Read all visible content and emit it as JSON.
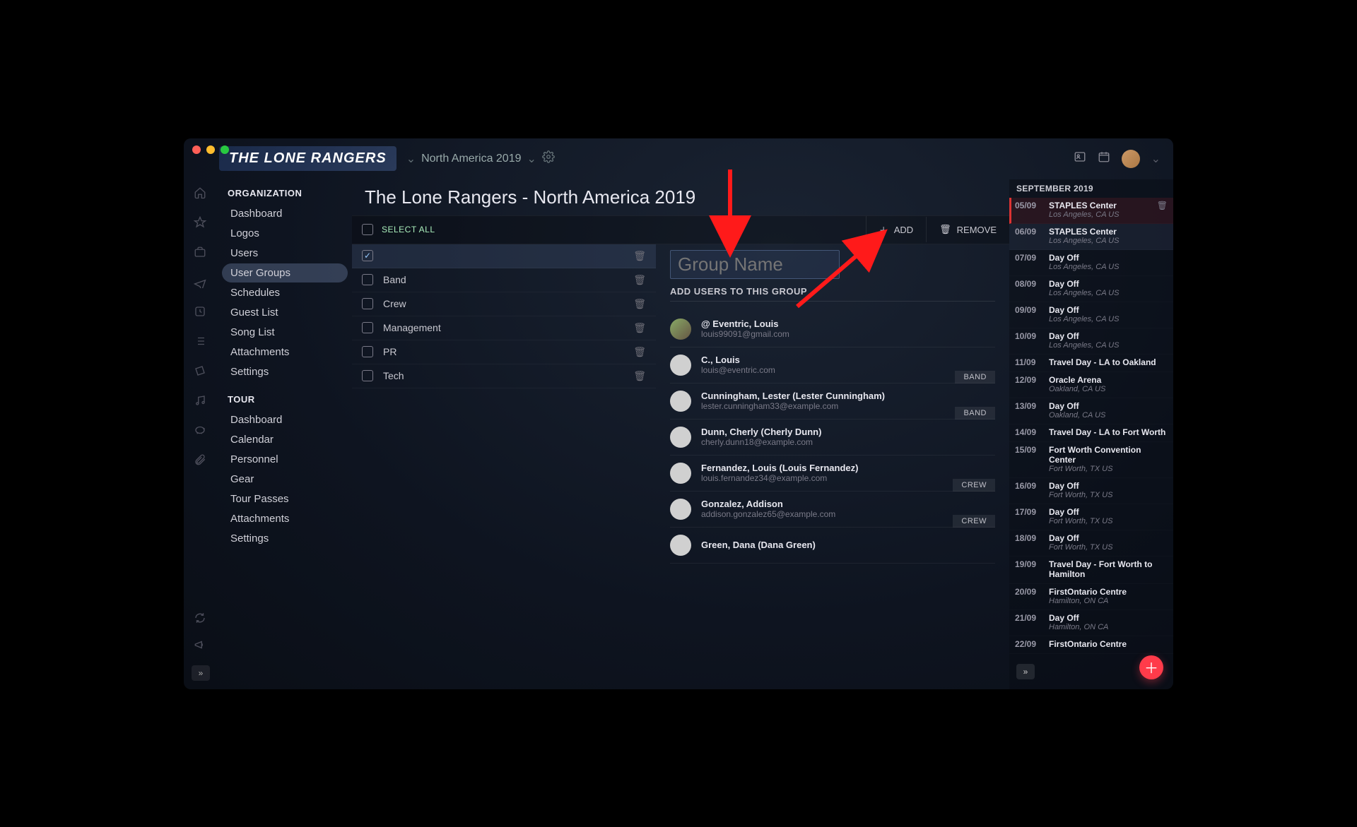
{
  "brand": "THE LONE RANGERS",
  "tour_selector": "North America 2019",
  "page_title": "The Lone Rangers - North America 2019",
  "toolbar": {
    "select_all": "SELECT ALL",
    "add": "ADD",
    "remove": "REMOVE"
  },
  "nav": {
    "organization": {
      "heading": "ORGANIZATION",
      "items": [
        "Dashboard",
        "Logos",
        "Users",
        "User Groups",
        "Schedules",
        "Guest List",
        "Song List",
        "Attachments",
        "Settings"
      ],
      "active": "User Groups"
    },
    "tour": {
      "heading": "TOUR",
      "items": [
        "Dashboard",
        "Calendar",
        "Personnel",
        "Gear",
        "Tour Passes",
        "Attachments",
        "Settings"
      ]
    }
  },
  "groups": [
    {
      "name": "",
      "checked": true,
      "selected": true
    },
    {
      "name": "Band"
    },
    {
      "name": "Crew"
    },
    {
      "name": "Management"
    },
    {
      "name": "PR"
    },
    {
      "name": "Tech"
    }
  ],
  "detail": {
    "group_name_placeholder": "Group Name",
    "add_users_heading": "ADD USERS TO THIS GROUP",
    "users": [
      {
        "name": "@ Eventric, Louis",
        "email": "louis99091@gmail.com",
        "photo": true
      },
      {
        "name": "C., Louis",
        "email": "louis@eventric.com",
        "badge": "BAND"
      },
      {
        "name": "Cunningham, Lester (Lester Cunningham)",
        "email": "lester.cunningham33@example.com",
        "badge": "BAND"
      },
      {
        "name": "Dunn, Cherly (Cherly Dunn)",
        "email": "cherly.dunn18@example.com"
      },
      {
        "name": "Fernandez, Louis (Louis Fernandez)",
        "email": "louis.fernandez34@example.com",
        "badge": "CREW"
      },
      {
        "name": "Gonzalez, Addison",
        "email": "addison.gonzalez65@example.com",
        "badge": "CREW"
      },
      {
        "name": "Green, Dana (Dana Green)",
        "email": ""
      }
    ]
  },
  "calendar": {
    "month": "SEPTEMBER 2019",
    "events": [
      {
        "date": "05/09",
        "title": "STAPLES Center",
        "loc": "Los Angeles, CA US",
        "hl": 1,
        "trash": true
      },
      {
        "date": "06/09",
        "title": "STAPLES Center",
        "loc": "Los Angeles, CA US",
        "hl": 2
      },
      {
        "date": "07/09",
        "title": "Day Off",
        "loc": "Los Angeles, CA US"
      },
      {
        "date": "08/09",
        "title": "Day Off",
        "loc": "Los Angeles, CA US"
      },
      {
        "date": "09/09",
        "title": "Day Off",
        "loc": "Los Angeles, CA US"
      },
      {
        "date": "10/09",
        "title": "Day Off",
        "loc": "Los Angeles, CA US"
      },
      {
        "date": "11/09",
        "title": "Travel Day - LA to Oakland",
        "loc": ""
      },
      {
        "date": "12/09",
        "title": "Oracle Arena",
        "loc": "Oakland, CA US"
      },
      {
        "date": "13/09",
        "title": "Day Off",
        "loc": "Oakland, CA US"
      },
      {
        "date": "14/09",
        "title": "Travel Day - LA to Fort Worth",
        "loc": ""
      },
      {
        "date": "15/09",
        "title": "Fort Worth Convention Center",
        "loc": "Fort Worth, TX US"
      },
      {
        "date": "16/09",
        "title": "Day Off",
        "loc": "Fort Worth, TX US"
      },
      {
        "date": "17/09",
        "title": "Day Off",
        "loc": "Fort Worth, TX US"
      },
      {
        "date": "18/09",
        "title": "Day Off",
        "loc": "Fort Worth, TX US"
      },
      {
        "date": "19/09",
        "title": "Travel Day - Fort Worth to Hamilton",
        "loc": ""
      },
      {
        "date": "20/09",
        "title": "FirstOntario Centre",
        "loc": "Hamilton, ON CA"
      },
      {
        "date": "21/09",
        "title": "Day Off",
        "loc": "Hamilton, ON CA"
      },
      {
        "date": "22/09",
        "title": "FirstOntario Centre",
        "loc": ""
      }
    ]
  }
}
